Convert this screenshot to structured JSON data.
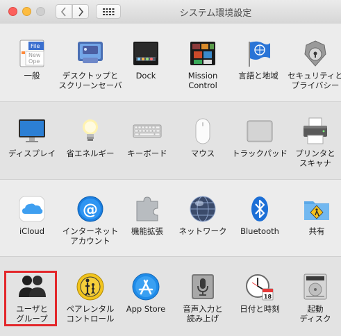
{
  "window": {
    "title": "システム環境設定",
    "back_label": "‹",
    "forward_label": "›"
  },
  "sections": [
    {
      "items": [
        {
          "label": "一般",
          "icon": "general-icon"
        },
        {
          "label": "デスクトップと\nスクリーンセーバ",
          "icon": "desktop-screensaver-icon"
        },
        {
          "label": "Dock",
          "icon": "dock-icon"
        },
        {
          "label": "Mission\nControl",
          "icon": "mission-control-icon"
        },
        {
          "label": "言語と地域",
          "icon": "language-region-icon"
        },
        {
          "label": "セキュリティと\nプライバシー",
          "icon": "security-privacy-icon"
        }
      ]
    },
    {
      "items": [
        {
          "label": "ディスプレイ",
          "icon": "display-icon"
        },
        {
          "label": "省エネルギー",
          "icon": "energy-saver-icon"
        },
        {
          "label": "キーボード",
          "icon": "keyboard-icon"
        },
        {
          "label": "マウス",
          "icon": "mouse-icon"
        },
        {
          "label": "トラックパッド",
          "icon": "trackpad-icon"
        },
        {
          "label": "プリンタと\nスキャナ",
          "icon": "printer-scanner-icon"
        }
      ]
    },
    {
      "items": [
        {
          "label": "iCloud",
          "icon": "icloud-icon"
        },
        {
          "label": "インターネット\nアカウント",
          "icon": "internet-accounts-icon"
        },
        {
          "label": "機能拡張",
          "icon": "extensions-icon"
        },
        {
          "label": "ネットワーク",
          "icon": "network-icon"
        },
        {
          "label": "Bluetooth",
          "icon": "bluetooth-icon"
        },
        {
          "label": "共有",
          "icon": "sharing-icon"
        }
      ]
    },
    {
      "items": [
        {
          "label": "ユーザと\nグループ",
          "icon": "users-groups-icon",
          "highlighted": true
        },
        {
          "label": "ペアレンタル\nコントロール",
          "icon": "parental-controls-icon"
        },
        {
          "label": "App Store",
          "icon": "app-store-icon"
        },
        {
          "label": "音声入力と\n読み上げ",
          "icon": "dictation-speech-icon"
        },
        {
          "label": "日付と時刻",
          "icon": "date-time-icon"
        },
        {
          "label": "起動\nディスク",
          "icon": "startup-disk-icon"
        }
      ]
    }
  ],
  "general_icon_lines": [
    "File",
    "New",
    "Ope"
  ],
  "calendar_day": "18",
  "colors": {
    "highlight": "#e3272b",
    "traffic_red": "#fc605c",
    "traffic_yellow": "#fdbc40"
  }
}
